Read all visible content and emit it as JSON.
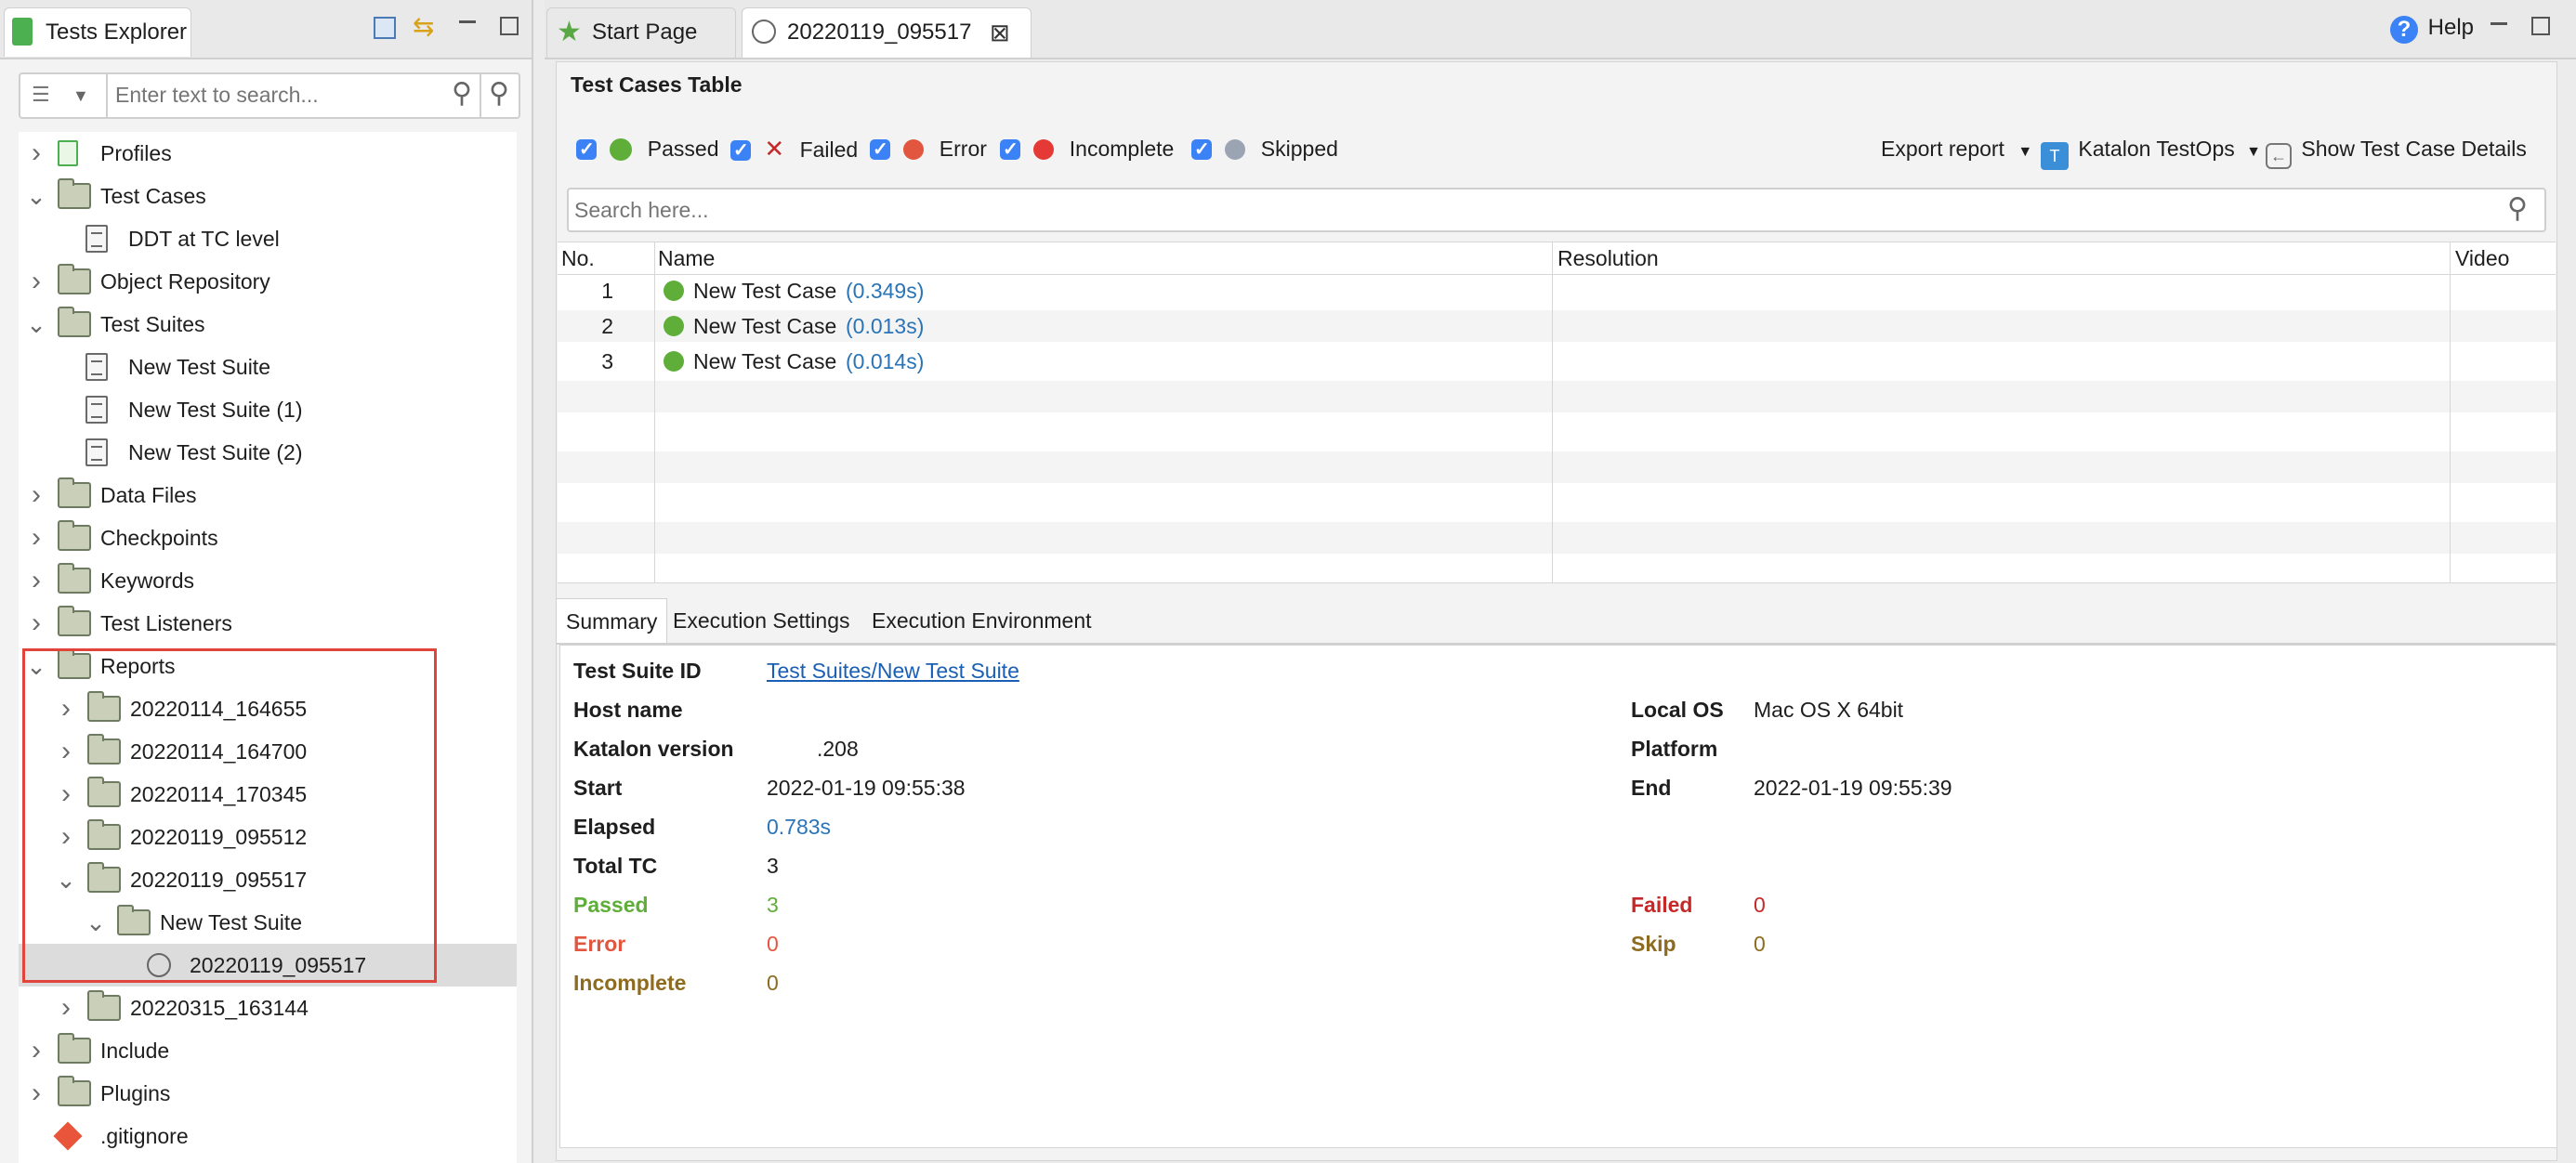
{
  "left_panel": {
    "title": "Tests Explorer",
    "search_placeholder": "Enter text to search...",
    "tree": [
      {
        "label": "Profiles",
        "chev": ">",
        "icon": "profiles-icon"
      },
      {
        "label": "Test Cases",
        "chev": "v",
        "icon": "test-cases-icon"
      },
      {
        "label": "DDT at TC level",
        "chev": "",
        "icon": "test-case-file-icon"
      },
      {
        "label": "Object Repository",
        "chev": ">",
        "icon": "object-repository-icon"
      },
      {
        "label": "Test Suites",
        "chev": "v",
        "icon": "test-suites-icon"
      },
      {
        "label": "New Test Suite",
        "chev": "",
        "icon": "test-suite-file-icon"
      },
      {
        "label": "New Test Suite (1)",
        "chev": "",
        "icon": "test-suite-file-icon"
      },
      {
        "label": "New Test Suite (2)",
        "chev": "",
        "icon": "test-suite-file-icon"
      },
      {
        "label": "Data Files",
        "chev": ">",
        "icon": "data-files-icon"
      },
      {
        "label": "Checkpoints",
        "chev": ">",
        "icon": "checkpoints-icon"
      },
      {
        "label": "Keywords",
        "chev": ">",
        "icon": "keywords-icon"
      },
      {
        "label": "Test Listeners",
        "chev": ">",
        "icon": "folder-icon"
      },
      {
        "label": "Reports",
        "chev": "v",
        "icon": "reports-icon"
      },
      {
        "label": "20220114_164655",
        "chev": ">",
        "icon": "folder-icon"
      },
      {
        "label": "20220114_164700",
        "chev": ">",
        "icon": "folder-icon"
      },
      {
        "label": "20220114_170345",
        "chev": ">",
        "icon": "folder-icon"
      },
      {
        "label": "20220119_095512",
        "chev": ">",
        "icon": "folder-icon"
      },
      {
        "label": "20220119_095517",
        "chev": "v",
        "icon": "folder-icon"
      },
      {
        "label": "New Test Suite",
        "chev": "v",
        "icon": "folder-icon"
      },
      {
        "label": "20220119_095517",
        "chev": "",
        "icon": "report-icon"
      },
      {
        "label": "20220315_163144",
        "chev": ">",
        "icon": "folder-icon"
      },
      {
        "label": "Include",
        "chev": ">",
        "icon": "folder-icon"
      },
      {
        "label": "Plugins",
        "chev": ">",
        "icon": "folder-icon"
      },
      {
        "label": ".gitignore",
        "chev": "",
        "icon": "git-icon"
      }
    ]
  },
  "editor_tabs": [
    {
      "label": "Start Page"
    },
    {
      "label": "20220119_095517"
    }
  ],
  "help_label": "Help",
  "test_cases_table": {
    "title": "Test Cases Table",
    "filters": [
      "Passed",
      "Failed",
      "Error",
      "Incomplete",
      "Skipped"
    ],
    "export_label": "Export report",
    "testops_label": "Katalon TestOps",
    "details_label": "Show Test Case Details",
    "search_placeholder": "Search here...",
    "columns": [
      "No.",
      "Name",
      "Resolution",
      "Video"
    ],
    "rows": [
      {
        "no": "1",
        "name": "New Test Case",
        "time": "(0.349s)"
      },
      {
        "no": "2",
        "name": "New Test Case",
        "time": "(0.013s)"
      },
      {
        "no": "3",
        "name": "New Test Case",
        "time": "(0.014s)"
      }
    ]
  },
  "bottom_tabs": [
    "Summary",
    "Execution Settings",
    "Execution Environment"
  ],
  "summary": {
    "test_suite_id_label": "Test Suite ID",
    "test_suite_id": "Test Suites/New Test Suite",
    "host_name_label": "Host name",
    "katalon_version_label": "Katalon version",
    "katalon_version": ".208",
    "start_label": "Start",
    "start": "2022-01-19 09:55:38",
    "elapsed_label": "Elapsed",
    "elapsed": "0.783s",
    "total_tc_label": "Total TC",
    "total_tc": "3",
    "passed_label": "Passed",
    "passed": "3",
    "error_label": "Error",
    "error": "0",
    "incomplete_label": "Incomplete",
    "incomplete": "0",
    "local_os_label": "Local OS",
    "local_os": "Mac OS X 64bit",
    "platform_label": "Platform",
    "end_label": "End",
    "end": "2022-01-19 09:55:39",
    "failed_label": "Failed",
    "failed": "0",
    "skip_label": "Skip",
    "skip": "0"
  },
  "colors": {
    "passed": "#5fae3a",
    "failed": "#c62828",
    "error": "#e2553f",
    "skip": "#8d6b1f",
    "incomplete": "#8d6b1f",
    "link": "#1a5fb4",
    "highlight_box": "#e0443a"
  }
}
